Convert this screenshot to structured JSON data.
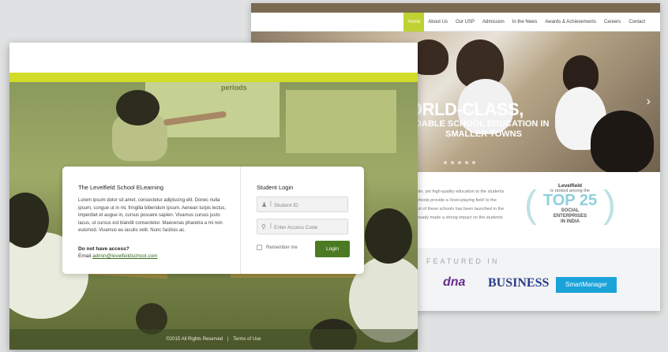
{
  "site": {
    "nav": [
      "Home",
      "About Us",
      "Our USP",
      "Admission",
      "In the News",
      "Awards & Achievements",
      "Careers",
      "Contact"
    ],
    "active_nav": "Home",
    "hero": {
      "headline": "ORLD-CLASS,",
      "subline1": "RDABLE SCHOOL EDUCATION IN",
      "subline2": "SMALLER TOWNS"
    },
    "about_lines": [
      "able, yet high-quality education to the students",
      "schools provide a 'level-playing field' to the",
      "first of these schools has been launched in the",
      "already made a strong impact on the students"
    ],
    "award": {
      "name": "Levelfield",
      "ranked": "is ranked among the",
      "top": "TOP 25",
      "line1": "SOCIAL",
      "line2": "ENTERPRISES",
      "line3": "IN INDIA"
    },
    "featured": {
      "title": "FEATURED IN",
      "logos": [
        "dna",
        "BUSINESS",
        "SmartManager"
      ]
    }
  },
  "front": {
    "board_text": "periods",
    "card": {
      "title": "The Levelfield School ELearning",
      "body": "Lorem ipsum dolor sit amet, consectetur adipiscing elit. Donec nulla ipsum, congue ut in mi, fringilla bibendum ipsum. Aenean turpis lectus, imperdiet et augue in, cursus posuere sapien. Vivamus cursus justo lacus, ut cursus est blandit consectetur. Maecenas pharetra a mi non euismod. Vivamus eu iaculis velit. Nunc facilisis ac.",
      "no_access": "Do not have access?",
      "email_label": "Email",
      "email": "admin@levelfeildschool.com"
    },
    "login": {
      "title": "Student Login",
      "student_id_placeholder": "Student ID",
      "access_code_placeholder": "Enter Access Code",
      "remember": "Remember me",
      "button": "Login"
    },
    "footer": {
      "copyright": "©2015 All Rights Reserved",
      "separator": "|",
      "terms": "Terms of Use"
    }
  }
}
